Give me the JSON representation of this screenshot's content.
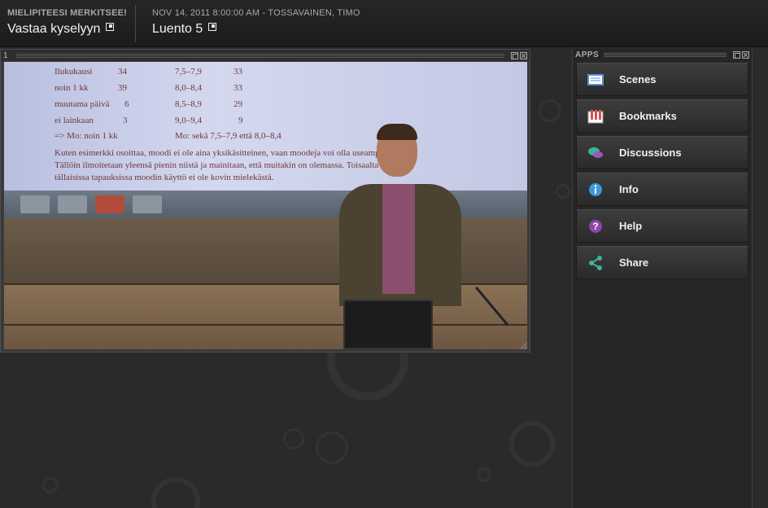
{
  "header": {
    "left_caption": "MIELIPITEESI MERKITSEE!",
    "left_link": "Vastaa kyselyyn",
    "meta": "NOV 14, 2011 8:00:00 AM - TOSSAVAINEN, TIMO",
    "title": "Luento 5"
  },
  "video_panel": {
    "number": "1",
    "slide_lines": [
      {
        "col1": "Ilukukausi",
        "col2": "34",
        "col3": "7,5–7,9",
        "col4": "33"
      },
      {
        "col1": "noin 1 kk",
        "col2": "39",
        "col3": "8,0–8,4",
        "col4": "33"
      },
      {
        "col1": "muutama päivä",
        "col2": "6",
        "col3": "8,5–8,9",
        "col4": "29"
      },
      {
        "col1": "ei lainkaan",
        "col2": "3",
        "col3": "9,0–9,4",
        "col4": "9"
      }
    ],
    "slide_summary": "=> Mo:  noin 1 kk",
    "slide_summary2": "Mo:  sekä 7,5–7,9 että 8,0–8,4",
    "slide_paragraph": [
      "Kuten esimerkki osoittaa, moodi ei ole aina yksikäsitteinen, vaan moodeja voi olla useampia.",
      "Tällöin ilmoitetaan yleensä pienin niistä ja mainitaan, että muitakin on olemassa. Toisaalta",
      "tällaisissa tapauksissa moodin käyttö ei ole kovin mielekästä."
    ]
  },
  "apps": {
    "title": "APPS",
    "items": [
      {
        "label": "Scenes",
        "icon": "scenes-icon",
        "color": "#5b8fd6"
      },
      {
        "label": "Bookmarks",
        "icon": "bookmarks-icon",
        "color": "#d9534f"
      },
      {
        "label": "Discussions",
        "icon": "discussions-icon",
        "color": "#9b59b6"
      },
      {
        "label": "Info",
        "icon": "info-icon",
        "color": "#3a9ad9"
      },
      {
        "label": "Help",
        "icon": "help-icon",
        "color": "#8e44ad"
      },
      {
        "label": "Share",
        "icon": "share-icon",
        "color": "#3cb49a"
      }
    ]
  }
}
